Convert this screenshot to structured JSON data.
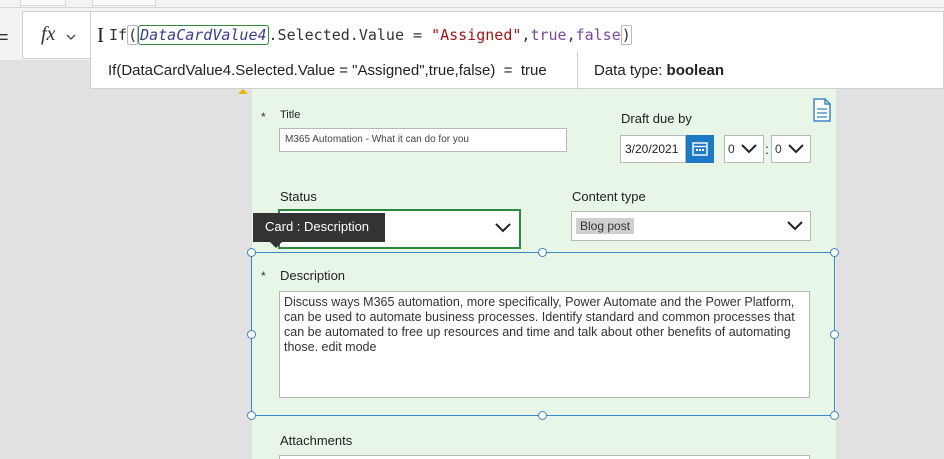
{
  "formula_bar": {
    "equals_symbol": "=",
    "fx_label": "fx",
    "cursor_glyph": "I",
    "tokens": {
      "func": "If",
      "paren_open": "(",
      "ref": "DataCardValue4",
      "member": ".Selected.Value = ",
      "string": "\"Assigned\"",
      "comma1": ",",
      "true_kw": "true",
      "comma2": ",",
      "false_kw": "false",
      "paren_close": ")"
    },
    "eval_expression": "If(DataCardValue4.Selected.Value = \"Assigned\",true,false)  =  true",
    "data_type_label": "Data type: ",
    "data_type_value": "boolean"
  },
  "form": {
    "title_label": "Title",
    "title_required": "*",
    "title_value": "M365 Automation - What it can do for you",
    "draft_due_label": "Draft due by",
    "draft_due_date": "3/20/2021",
    "hour_value": "0",
    "minute_sep": ":",
    "minute_value": "0",
    "status_label": "Status",
    "content_type_label": "Content type",
    "content_type_value": "Blog post",
    "tooltip_text": "Card : Description",
    "description_required": "*",
    "description_label": "Description",
    "description_value": "Discuss ways M365 automation, more specifically, Power Automate and the Power Platform, can be used to automate business processes. Identify standard and common processes that can be automated to free up resources and time and talk about other benefits of automating those. edit mode",
    "attachments_label": "Attachments"
  },
  "icons": {
    "fx_chevron": "chevron-down-icon",
    "calendar": "calendar-icon",
    "select_chevron": "chevron-down-icon",
    "document": "document-icon",
    "warning": "warning-icon"
  },
  "colors": {
    "form_background": "#e8f6e8",
    "selection_border": "#3a87c8",
    "focus_border": "#2b8a3e",
    "calendar_accent": "#1f7ac6",
    "tooltip_background": "#333333",
    "string_token": "#a31515"
  }
}
